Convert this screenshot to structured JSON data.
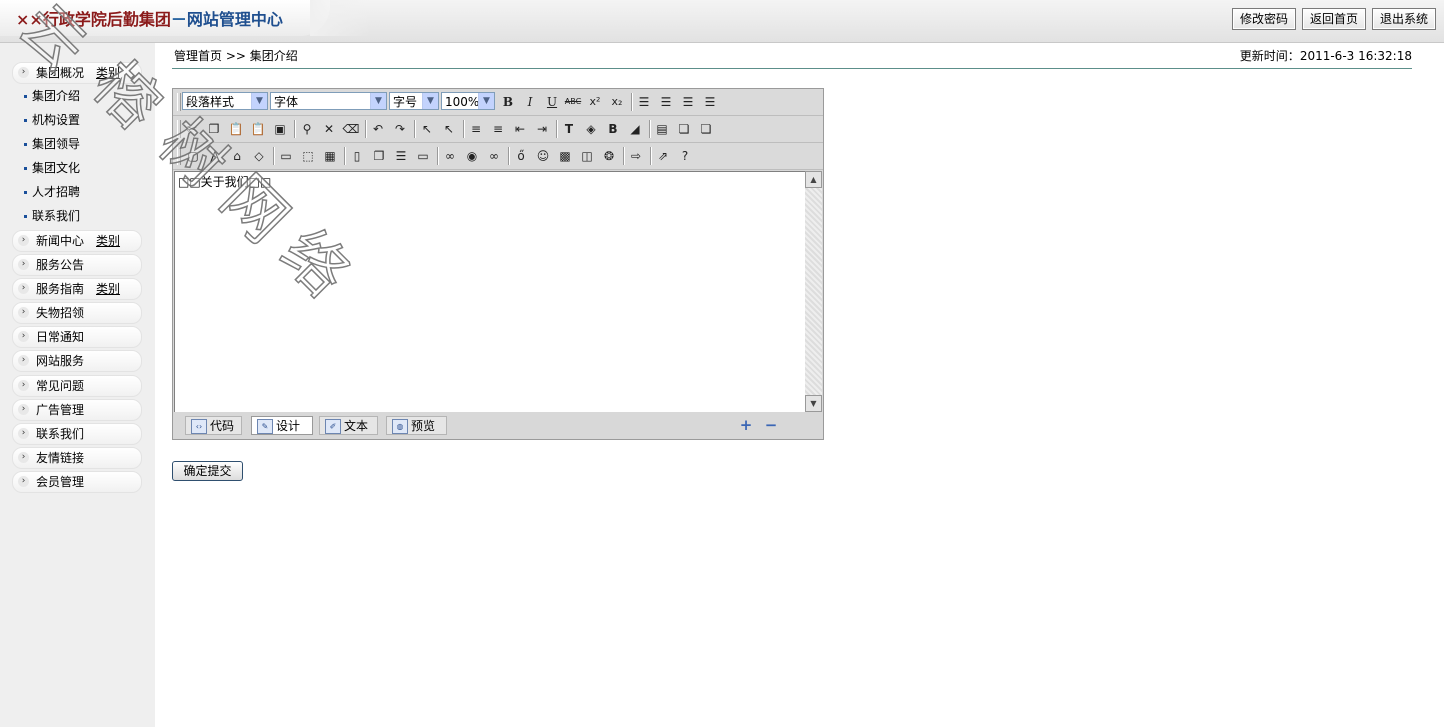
{
  "header": {
    "org_name": "××行政学院后勤集团",
    "separator": "－",
    "system_name": "网站管理中心",
    "buttons": [
      "修改密码",
      "返回首页",
      "退出系统"
    ]
  },
  "sidebar": {
    "categories": [
      {
        "label": "集团概况",
        "extra": "类别"
      },
      {
        "label": "新闻中心",
        "extra": "类别"
      },
      {
        "label": "服务公告"
      },
      {
        "label": "服务指南",
        "extra": "类别"
      },
      {
        "label": "失物招领"
      },
      {
        "label": "日常通知"
      },
      {
        "label": "网站服务"
      },
      {
        "label": "常见问题"
      },
      {
        "label": "广告管理"
      },
      {
        "label": "联系我们"
      },
      {
        "label": "友情链接"
      },
      {
        "label": "会员管理"
      }
    ],
    "sub_items": [
      "集团介绍",
      "机构设置",
      "集团领导",
      "集团文化",
      "人才招聘",
      "联系我们"
    ]
  },
  "breadcrumb": {
    "home": "管理首页",
    "sep": ">>",
    "current": "集团介绍"
  },
  "updated": {
    "label": "更新时间：",
    "value": "2011-6-3 16:32:18"
  },
  "editor": {
    "paragraph_style": "段落样式",
    "font": "字体",
    "font_size": "字号",
    "zoom": "100%",
    "content": "□□关于我们□□",
    "modes": [
      "代码",
      "设计",
      "文本",
      "预览"
    ],
    "active_mode": "设计"
  },
  "submit_label": "确定提交",
  "watermark": "云榕树网络",
  "colors": {
    "accent_red": "#8b1a1a",
    "accent_blue": "#1f4f8f",
    "rule": "#5c8f8a"
  }
}
